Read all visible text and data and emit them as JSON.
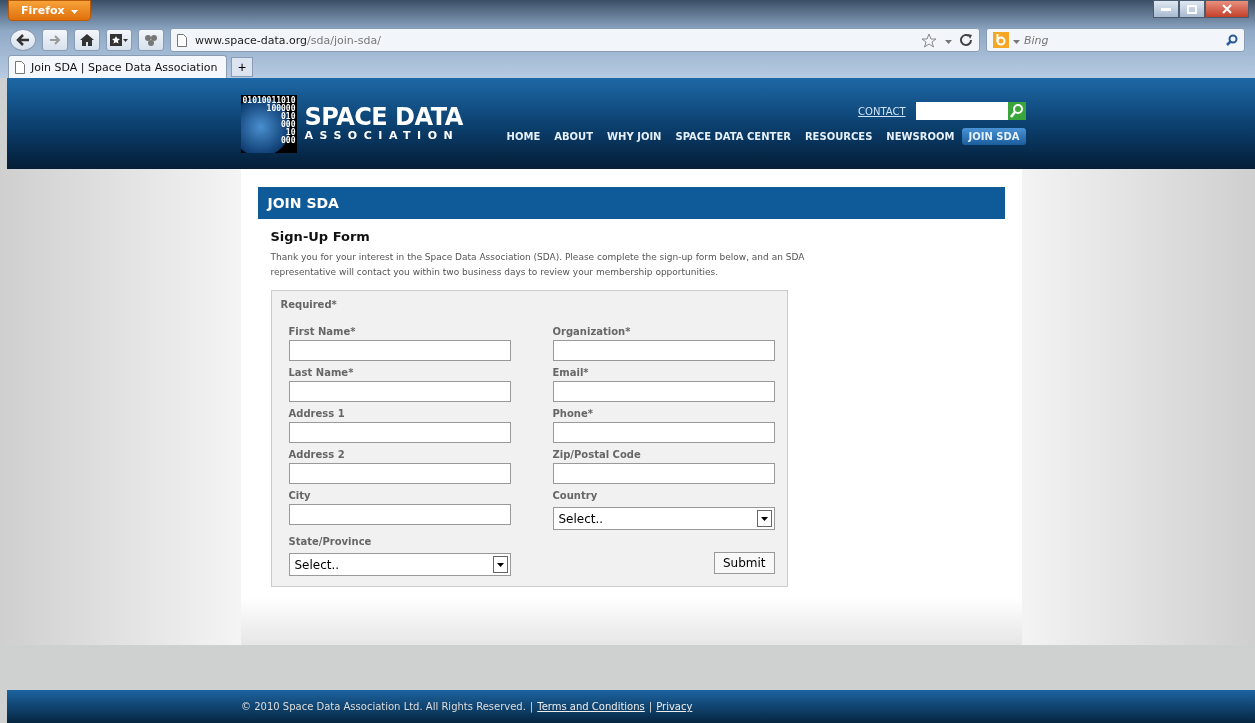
{
  "browser": {
    "menu_button": "Firefox",
    "url_host": "www.space-data.org",
    "url_path": "/sda/join-sda/",
    "search_placeholder": "Bing",
    "tabs": [
      {
        "label": "Join SDA | Space Data Association",
        "selected": true
      }
    ],
    "new_tab": "+"
  },
  "header": {
    "logo": {
      "binary": [
        "01010011010",
        "100000",
        "010",
        "000",
        "10",
        "000"
      ],
      "title": "SPACE DATA",
      "subtitle": "ASSOCIATION"
    },
    "contact": "CONTACT",
    "nav": [
      {
        "label": "HOME",
        "selected": false
      },
      {
        "label": "ABOUT",
        "selected": false
      },
      {
        "label": "WHY JOIN",
        "selected": false
      },
      {
        "label": "SPACE DATA CENTER",
        "selected": false
      },
      {
        "label": "RESOURCES",
        "selected": false
      },
      {
        "label": "NEWSROOM",
        "selected": false
      },
      {
        "label": "JOIN SDA",
        "selected": true
      }
    ]
  },
  "page_title": "JOIN SDA",
  "form": {
    "title": "Sign-Up Form",
    "intro": "Thank you for your interest in the Space Data Association (SDA). Please complete the sign-up form below, and an SDA representative will contact you within two business days to review your membership opportunities.",
    "required_note": "Required*",
    "fields": [
      {
        "label": "First Name*",
        "kind": "text"
      },
      {
        "label": "Organization*",
        "kind": "text"
      },
      {
        "label": "Last Name*",
        "kind": "text"
      },
      {
        "label": "Email*",
        "kind": "text"
      },
      {
        "label": "Address 1",
        "kind": "text"
      },
      {
        "label": "Phone*",
        "kind": "text"
      },
      {
        "label": "Address 2",
        "kind": "text"
      },
      {
        "label": "Zip/Postal Code",
        "kind": "text"
      },
      {
        "label": "City",
        "kind": "text"
      },
      {
        "label": "Country",
        "kind": "select",
        "value": "Select.."
      },
      {
        "label": "State/Province",
        "kind": "select",
        "value": "Select.."
      }
    ],
    "submit": "Submit"
  },
  "footer": {
    "copyright": "© 2010 Space Data Association Ltd. All Rights Reserved.",
    "separator": "|",
    "links": [
      "Terms and Conditions",
      "Privacy"
    ]
  }
}
